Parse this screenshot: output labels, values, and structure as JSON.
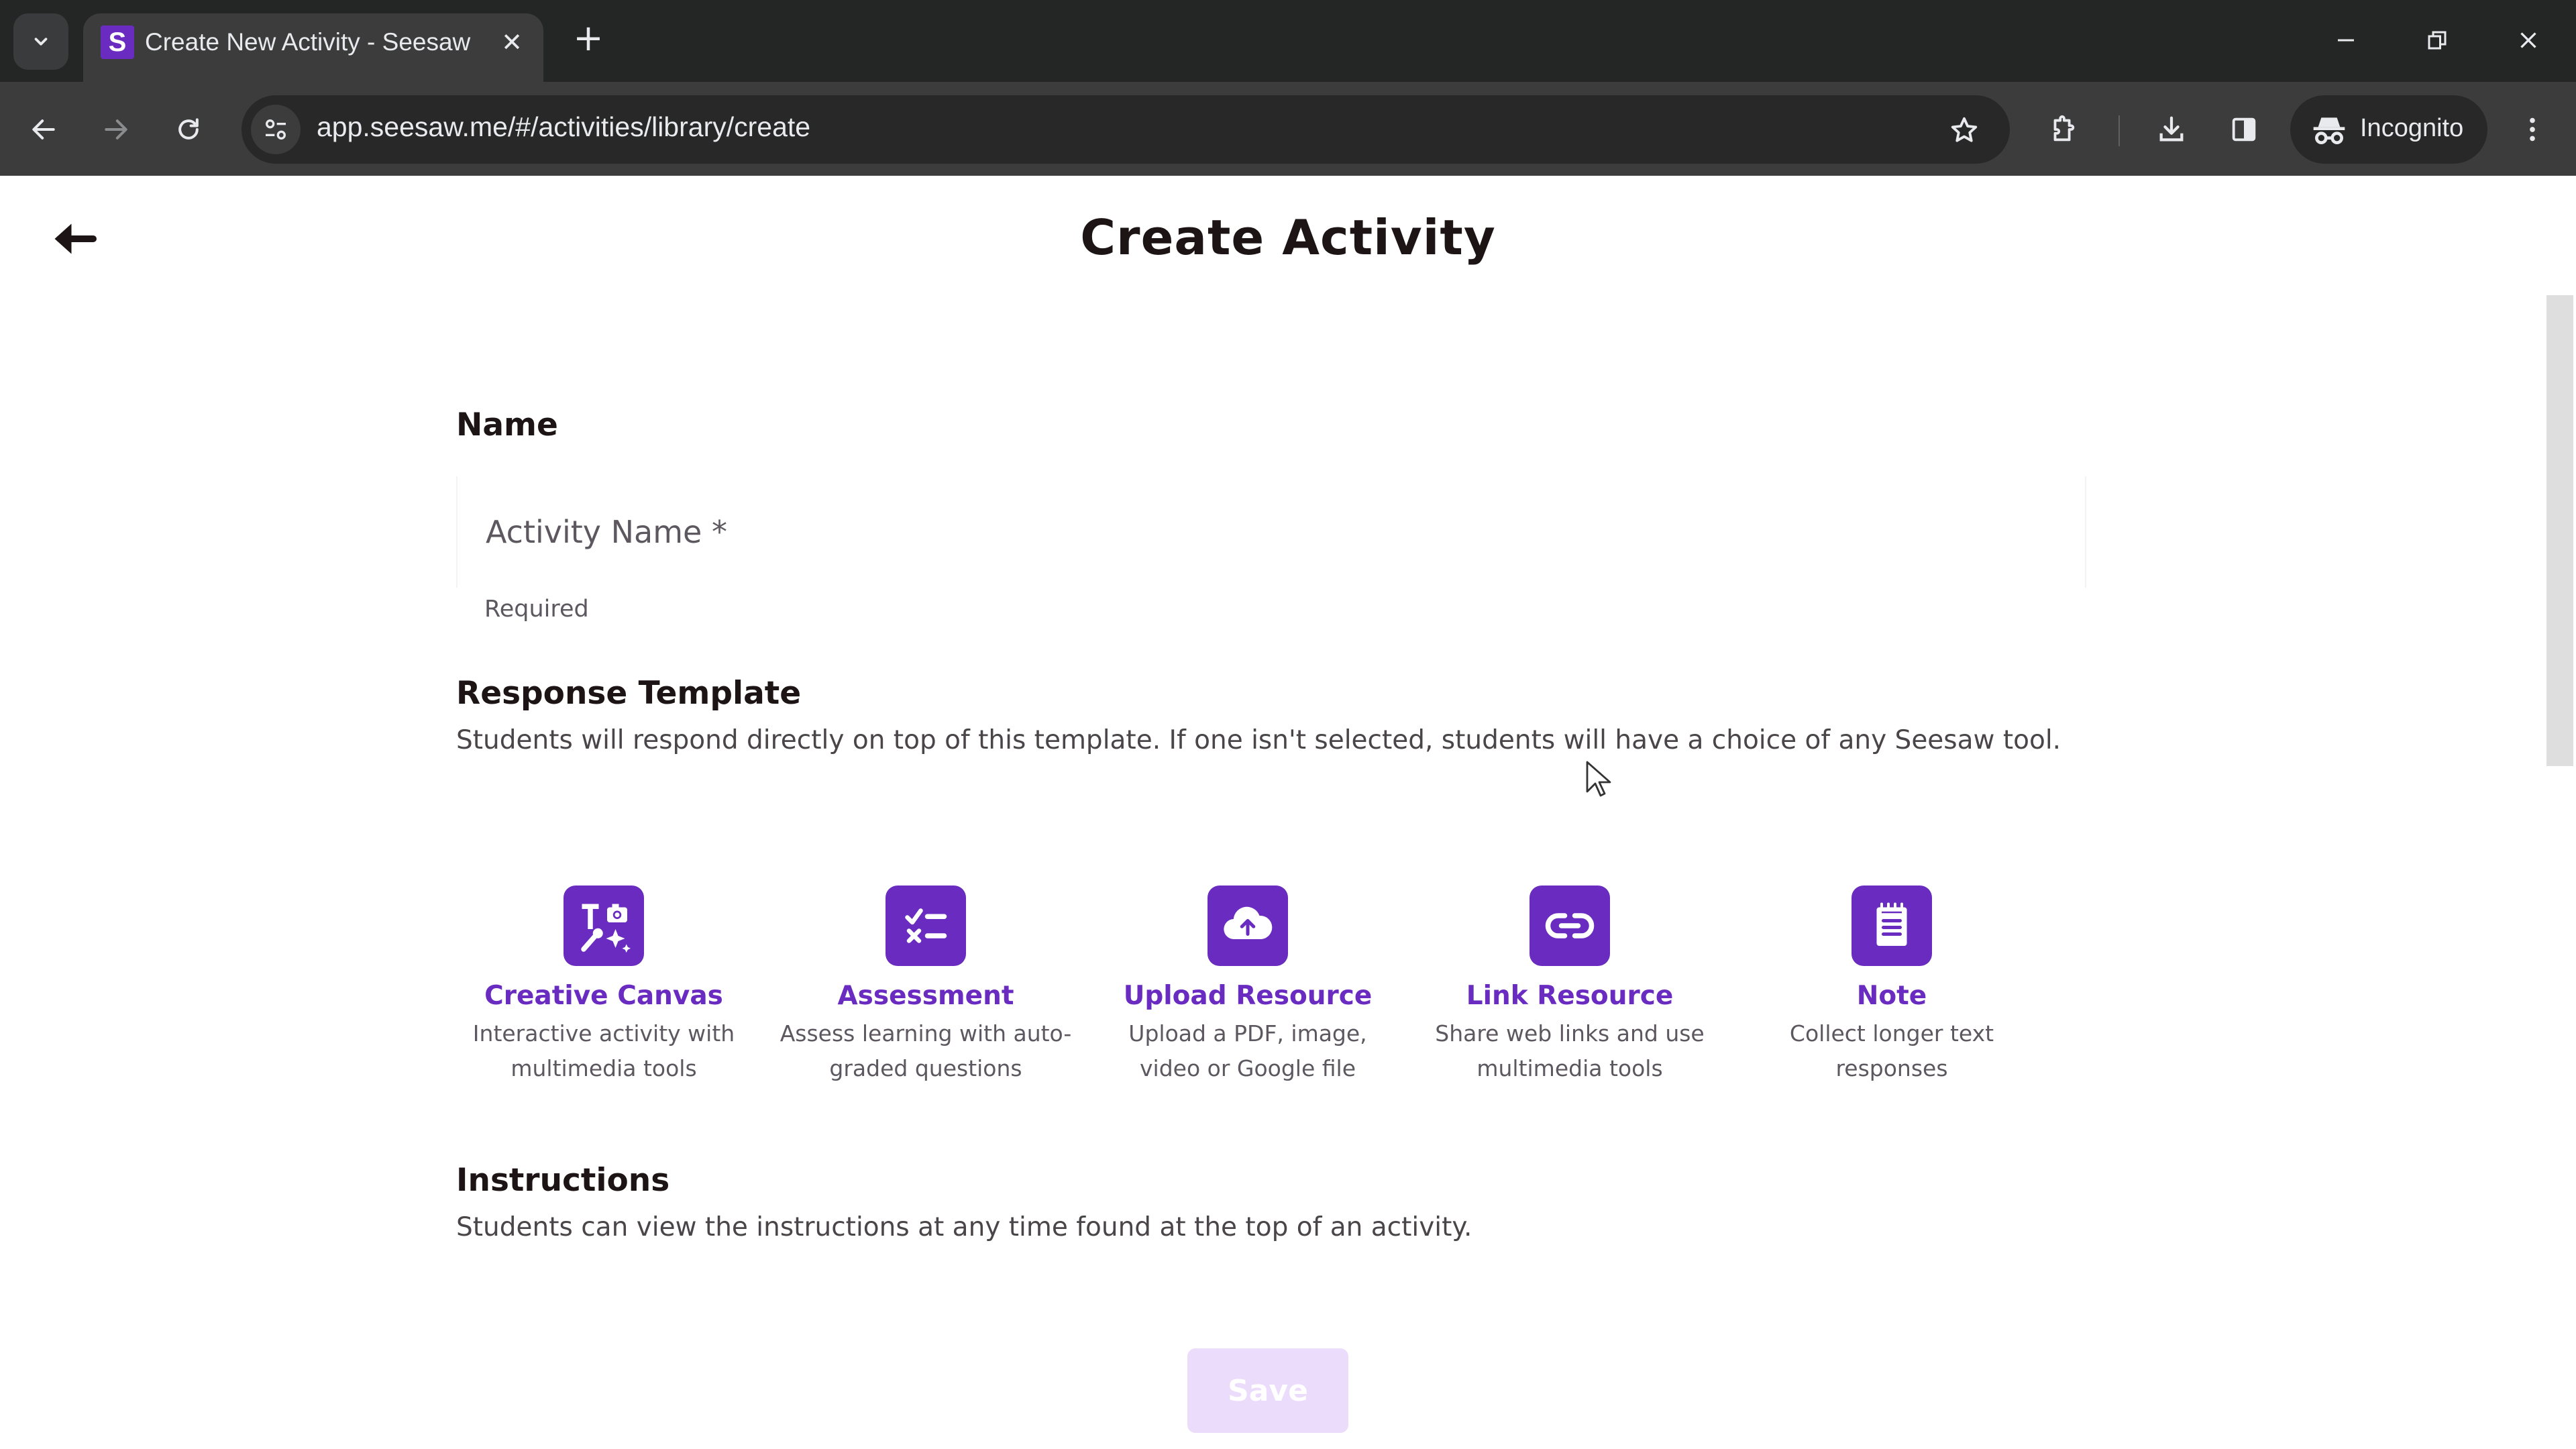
{
  "browser": {
    "tab": {
      "title": "Create New Activity - Seesaw",
      "favicon_letter": "S"
    },
    "url": "app.seesaw.me/#/activities/library/create",
    "incognito_label": "Incognito",
    "icons": {
      "tab_search": "chevron-down-icon",
      "tab_close": "close-icon",
      "new_tab": "plus-icon",
      "back": "arrow-left-icon",
      "forward": "arrow-right-icon",
      "reload": "reload-icon",
      "site_info": "tune-icon",
      "bookmark": "star-icon",
      "extensions": "puzzle-icon",
      "downloads": "download-icon",
      "side_panel": "side-panel-icon",
      "incognito": "incognito-icon",
      "menu": "kebab-menu-icon",
      "minimize": "minimize-icon",
      "restore": "restore-icon",
      "close_window": "close-icon"
    },
    "glyphs": {
      "close": "✕",
      "plus": "+"
    }
  },
  "page": {
    "title": "Create Activity",
    "back_icon": "arrow-left-icon",
    "name_section": {
      "label": "Name",
      "input_placeholder": "Activity Name *",
      "input_value": "",
      "helper_text": "Required"
    },
    "response_template": {
      "label": "Response Template",
      "description": "Students will respond directly on top of this template. If one isn't selected, students will have a choice of any Seesaw tool.",
      "options": [
        {
          "title": "Creative Canvas",
          "subtitle": "Interactive activity with multimedia tools",
          "icon": "creative-canvas-icon"
        },
        {
          "title": "Assessment",
          "subtitle": "Assess learning with auto-graded questions",
          "icon": "checklist-icon"
        },
        {
          "title": "Upload Resource",
          "subtitle": "Upload a PDF, image, video or Google file",
          "icon": "cloud-upload-icon"
        },
        {
          "title": "Link Resource",
          "subtitle": "Share web links and use multimedia tools",
          "icon": "link-icon"
        },
        {
          "title": "Note",
          "subtitle": "Collect longer text responses",
          "icon": "notepad-icon"
        }
      ]
    },
    "instructions": {
      "label": "Instructions",
      "description": "Students can view the instructions at any time found at the top of an activity."
    },
    "save_button": {
      "label": "Save",
      "state": "disabled"
    }
  },
  "colors": {
    "brand_purple": "#6a2bc0",
    "save_disabled_bg": "#ecdcfb",
    "heading_text": "#1c1415",
    "body_text": "#4a4549",
    "chrome_dark": "#242626",
    "chrome_toolbar": "#3c3c3c"
  }
}
